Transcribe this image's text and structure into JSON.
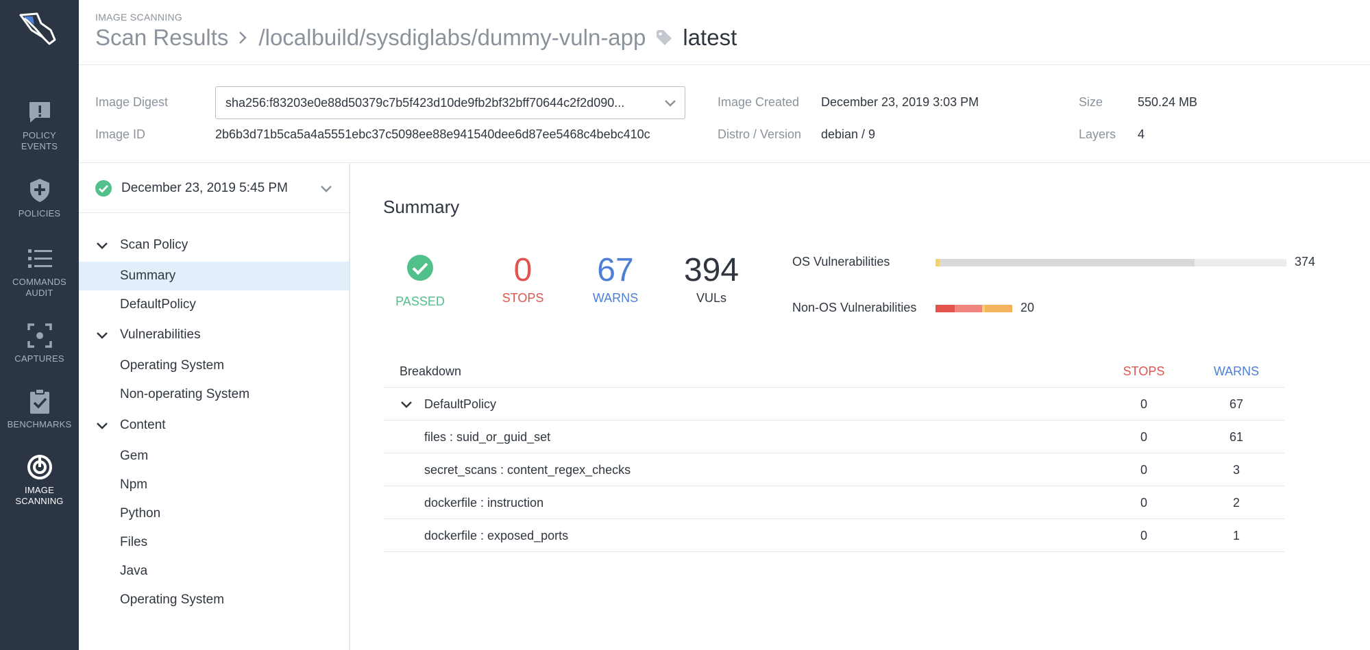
{
  "nav": {
    "items": [
      {
        "label": "POLICY EVENTS",
        "icon": "alert-icon"
      },
      {
        "label": "POLICIES",
        "icon": "shield-plus-icon"
      },
      {
        "label": "COMMANDS AUDIT",
        "icon": "list-icon"
      },
      {
        "label": "CAPTURES",
        "icon": "capture-icon"
      },
      {
        "label": "BENCHMARKS",
        "icon": "clipboard-check-icon"
      },
      {
        "label": "IMAGE SCANNING",
        "icon": "scan-icon",
        "active": true
      }
    ]
  },
  "header": {
    "eyebrow": "IMAGE SCANNING",
    "crumb_root": "Scan Results",
    "crumb_repo": "/localbuild/sysdiglabs/dummy-vuln-app",
    "tag": "latest"
  },
  "info": {
    "digest_label": "Image Digest",
    "digest_value": "sha256:f83203e0e88d50379c7b5f423d10de9fb2bf32bff70644c2f2d090...",
    "id_label": "Image ID",
    "id_value": "2b6b3d71b5ca5a4a5551ebc37c5098ee88e941540dee6d87ee5468c4bebc410c",
    "created_label": "Image Created",
    "created_value": "December 23, 2019 3:03 PM",
    "distro_label": "Distro / Version",
    "distro_value": "debian / 9",
    "size_label": "Size",
    "size_value": "550.24 MB",
    "layers_label": "Layers",
    "layers_value": "4"
  },
  "sidebar": {
    "scan_date": "December 23, 2019 5:45 PM",
    "sections": [
      {
        "title": "Scan Policy",
        "items": [
          "Summary",
          "DefaultPolicy"
        ]
      },
      {
        "title": "Vulnerabilities",
        "items": [
          "Operating System",
          "Non-operating System"
        ]
      },
      {
        "title": "Content",
        "items": [
          "Gem",
          "Npm",
          "Python",
          "Files",
          "Java",
          "Operating System"
        ]
      }
    ],
    "selected": "Summary"
  },
  "summary": {
    "title": "Summary",
    "passed_label": "PASSED",
    "stops_value": "0",
    "stops_label": "STOPS",
    "warns_value": "67",
    "warns_label": "WARNS",
    "vuls_value": "394",
    "vuls_label": "VULs",
    "os_vuln_label": "OS Vulnerabilities",
    "os_vuln_count": "374",
    "nonos_vuln_label": "Non-OS Vulnerabilities",
    "nonos_vuln_count": "20"
  },
  "colors": {
    "critical": "#e0544d",
    "high": "#ef857f",
    "medium": "#f4b35e",
    "low": "#f5d36b",
    "negligible": "#d9d9d9",
    "passed": "#52c08b",
    "warn": "#4d7fd6"
  },
  "breakdown": {
    "header": "Breakdown",
    "stops_header": "STOPS",
    "warns_header": "WARNS",
    "rows": [
      {
        "name": "DefaultPolicy",
        "stops": "0",
        "warns": "67",
        "group": true
      },
      {
        "name": "files : suid_or_guid_set",
        "stops": "0",
        "warns": "61"
      },
      {
        "name": "secret_scans : content_regex_checks",
        "stops": "0",
        "warns": "3"
      },
      {
        "name": "dockerfile : instruction",
        "stops": "0",
        "warns": "2"
      },
      {
        "name": "dockerfile : exposed_ports",
        "stops": "0",
        "warns": "1"
      }
    ]
  }
}
